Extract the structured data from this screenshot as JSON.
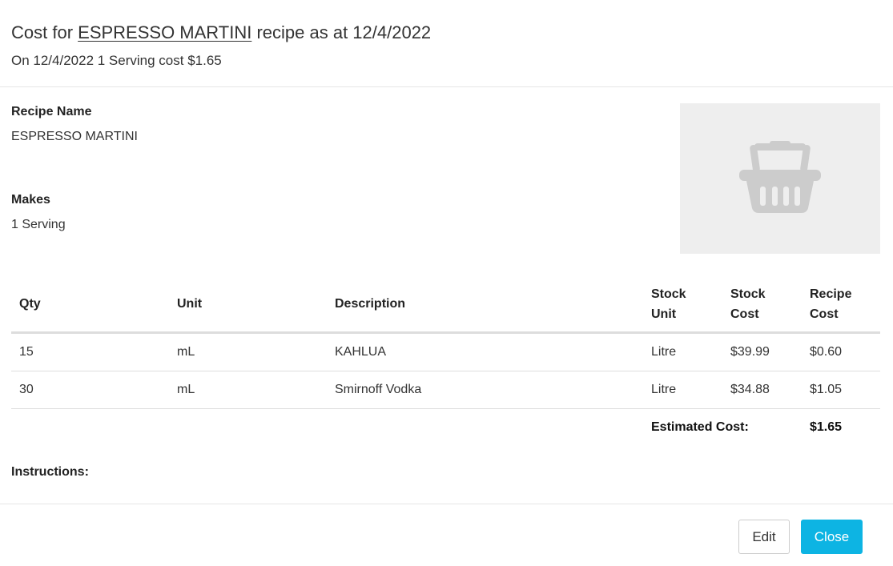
{
  "header": {
    "title_prefix": "Cost for ",
    "recipe_link": "ESPRESSO MARTINI",
    "title_suffix": " recipe as at 12/4/2022",
    "subtitle": "On 12/4/2022 1 Serving cost $1.65"
  },
  "recipe": {
    "name_label": "Recipe Name",
    "name_value": "ESPRESSO MARTINI",
    "makes_label": "Makes",
    "makes_value": "1 Serving",
    "image_icon": "basket-icon"
  },
  "table": {
    "headers": {
      "qty": "Qty",
      "unit": "Unit",
      "description": "Description",
      "stock_unit_1": "Stock",
      "stock_unit_2": "Unit",
      "stock_cost_1": "Stock",
      "stock_cost_2": "Cost",
      "recipe_cost_1": "Recipe",
      "recipe_cost_2": "Cost"
    },
    "rows": [
      {
        "qty": "15",
        "unit": "mL",
        "description": "KAHLUA",
        "stock_unit": "Litre",
        "stock_cost": "$39.99",
        "recipe_cost": "$0.60"
      },
      {
        "qty": "30",
        "unit": "mL",
        "description": "Smirnoff Vodka",
        "stock_unit": "Litre",
        "stock_cost": "$34.88",
        "recipe_cost": "$1.05"
      }
    ],
    "total_label": "Estimated Cost:",
    "total_value": "$1.65"
  },
  "instructions": {
    "label": "Instructions:"
  },
  "footer": {
    "edit_label": "Edit",
    "close_label": "Close"
  },
  "colors": {
    "accent": "#0db4e3",
    "link": "#1ab0dc",
    "image_bg": "#eeeeee",
    "icon": "#cccccc"
  }
}
